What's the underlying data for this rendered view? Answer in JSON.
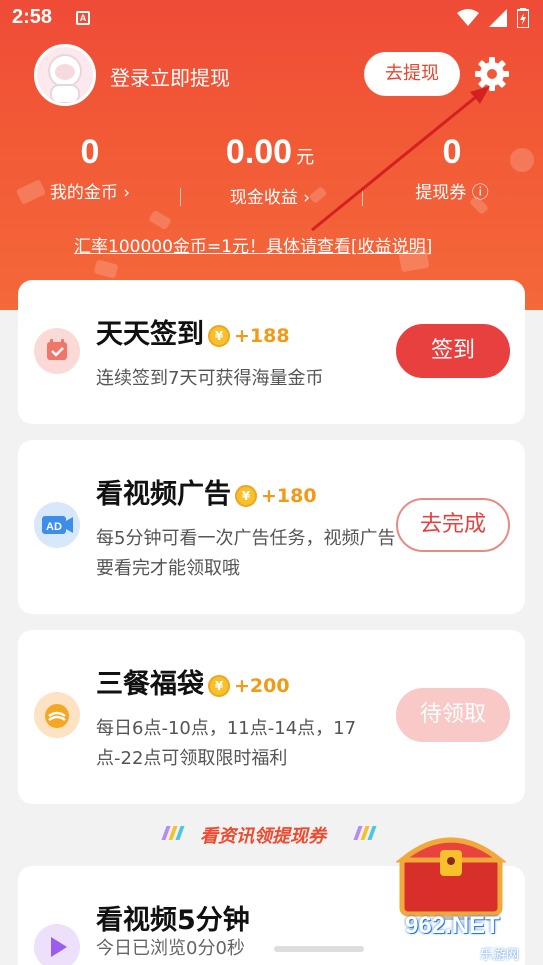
{
  "status_bar": {
    "time": "2:58",
    "notification_badge": "A"
  },
  "header": {
    "login_prompt": "登录立即提现",
    "withdraw_button": "去提现",
    "stats": [
      {
        "value": "0",
        "unit": "",
        "label": "我的金币 ›"
      },
      {
        "value": "0.00",
        "unit": "元",
        "label": "现金收益 ›"
      },
      {
        "value": "0",
        "unit": "",
        "label": "提现券 ⓘ"
      }
    ],
    "exchange_note": "汇率100000金币=1元！具体请查看[收益说明]"
  },
  "tasks": [
    {
      "title": "天天签到",
      "reward": "+188",
      "description": "连续签到7天可获得海量金币",
      "button": "签到",
      "button_style": "solid"
    },
    {
      "title": "看视频广告",
      "reward": "+180",
      "description": "每5分钟可看一次广告任务，视频广告要看完才能领取哦",
      "button": "去完成",
      "button_style": "outline"
    },
    {
      "title": "三餐福袋",
      "reward": "+200",
      "description": "每日6点-10点，11点-14点，17点-22点可领取限时福利",
      "button": "待领取",
      "button_style": "disabled"
    }
  ],
  "news_banner": "看资讯领提现券",
  "video_task": {
    "title": "看视频5分钟",
    "progress_text": "今日已浏览0分0秒",
    "progress_fraction": 0
  },
  "icons": {
    "coin": "¥",
    "ad": "AD"
  },
  "watermark": {
    "main": "962.NET",
    "sub": "乐游网"
  },
  "colors": {
    "brand_red": "#e8403e",
    "header_orange": "#f25a36",
    "reward_orange": "#f29a17"
  }
}
